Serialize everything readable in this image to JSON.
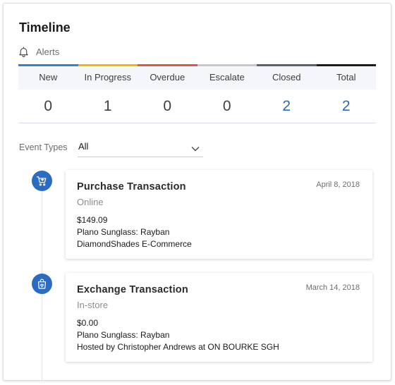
{
  "title": "Timeline",
  "alerts": {
    "label": "Alerts"
  },
  "stats": [
    {
      "label": "New",
      "value": "0",
      "color": "#3b7dd8",
      "link": false
    },
    {
      "label": "In Progress",
      "value": "1",
      "color": "#f4b400",
      "link": false
    },
    {
      "label": "Overdue",
      "value": "0",
      "color": "#d8594e",
      "link": false
    },
    {
      "label": "Escalate",
      "value": "0",
      "color": "#c6c9cc",
      "link": false
    },
    {
      "label": "Closed",
      "value": "2",
      "color": "#5a6270",
      "link": true
    },
    {
      "label": "Total",
      "value": "2",
      "color": "#1a1a1a",
      "link": true
    }
  ],
  "filter": {
    "label": "Event Types",
    "value": "All"
  },
  "events": [
    {
      "title": "Purchase Transaction",
      "channel": "Online",
      "date": "April 8, 2018",
      "amount": "$149.09",
      "product": "Plano Sunglass: Rayban",
      "detail": "DiamondShades E-Commerce",
      "icon": "cart-icon"
    },
    {
      "title": "Exchange Transaction",
      "channel": "In-store",
      "date": "March 14, 2018",
      "amount": "$0.00",
      "product": "Plano Sunglass: Rayban",
      "detail": "Hosted by Christopher Andrews at ON BOURKE SGH",
      "icon": "shopping-bag-icon"
    }
  ],
  "colors": {
    "accent": "#2a6cc2",
    "link": "#2f6ab1"
  }
}
